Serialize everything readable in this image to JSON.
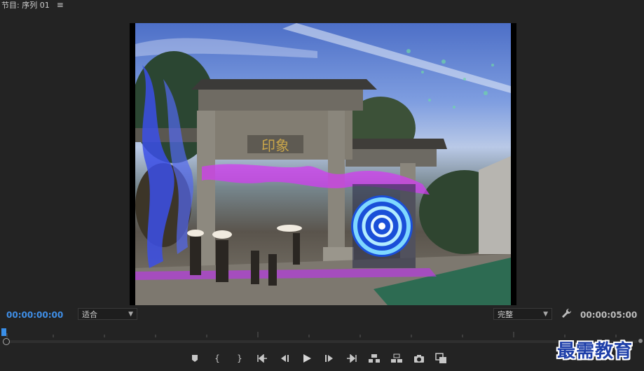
{
  "panel": {
    "title": "节目: 序列 01",
    "menu_icon": "hamburger-menu-icon"
  },
  "timecode": {
    "current": "00:00:00:00",
    "duration": "00:00:05:00"
  },
  "fit_select": {
    "value": "适合"
  },
  "quality_select": {
    "value": "完整"
  },
  "frame": {
    "sign_text": "印象"
  },
  "playback": {
    "playhead_position": 0.0
  },
  "transport_buttons": [
    {
      "name": "add-marker-button",
      "icon": "marker-icon"
    },
    {
      "name": "mark-in-button",
      "icon": "mark-in-icon"
    },
    {
      "name": "mark-out-button",
      "icon": "mark-out-icon"
    },
    {
      "name": "go-to-in-button",
      "icon": "go-to-in-icon"
    },
    {
      "name": "step-back-button",
      "icon": "step-back-icon"
    },
    {
      "name": "play-button",
      "icon": "play-icon"
    },
    {
      "name": "step-forward-button",
      "icon": "step-forward-icon"
    },
    {
      "name": "go-to-out-button",
      "icon": "go-to-out-icon"
    },
    {
      "name": "lift-button",
      "icon": "lift-icon"
    },
    {
      "name": "extract-button",
      "icon": "extract-icon"
    },
    {
      "name": "export-frame-button",
      "icon": "camera-icon"
    },
    {
      "name": "compare-view-button",
      "icon": "compare-icon"
    }
  ],
  "watermark": {
    "text": "最需教育"
  },
  "colors": {
    "accent_blue": "#3a8fe8",
    "background": "#232323",
    "effect_magenta": "#d23cf0"
  }
}
